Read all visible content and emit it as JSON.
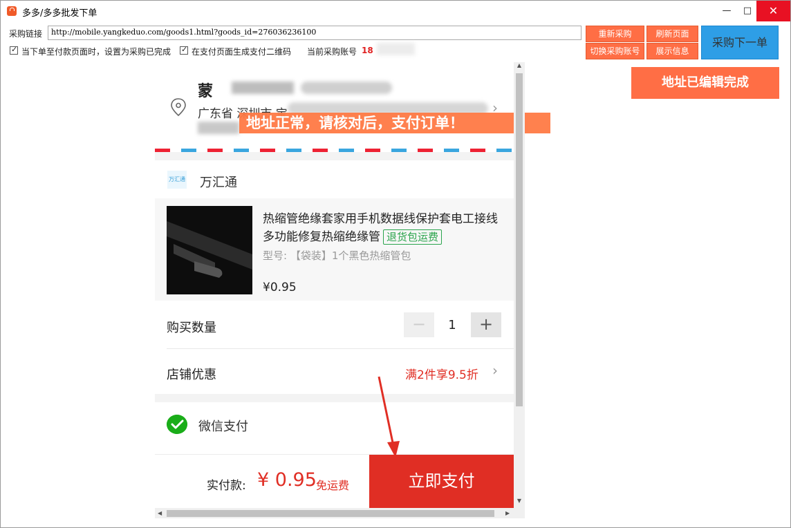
{
  "window": {
    "title": "多多/多多批发下单",
    "min_icon": "—",
    "max_icon": "□",
    "close_icon": "✕"
  },
  "toolbar": {
    "url_label": "采购链接",
    "url_value": "http://mobile.yangkeduo.com/goods1.html?goods_id=276036236100",
    "checkbox1_label": "当下单至付款页面时，设置为采购已完成",
    "checkbox2_label": "在支付页面生成支付二维码",
    "account_label": "当前采购账号",
    "account_value": "18",
    "redo_label": "重新采购",
    "refresh_label": "刷新页面",
    "switch_label": "切换采购账号",
    "info_label": "展示信息",
    "next_label": "采购下一单",
    "address_done_label": "地址已编辑完成"
  },
  "address": {
    "name": "蒙",
    "line": "广东省 深圳市 宝",
    "tip": "地址正常，请核对后，支付订单！"
  },
  "shop": {
    "logo_text": "万汇通",
    "name": "万汇通"
  },
  "product": {
    "title": "热缩管绝缘套家用手机数据线保护套电工接线多功能修复热缩绝缘管",
    "badge": "退货包运费",
    "spec": "型号: 【袋装】1个黑色热缩管包",
    "price": "¥0.95"
  },
  "quantity": {
    "label": "购买数量",
    "minus": "−",
    "value": "1",
    "plus": "+"
  },
  "coupon": {
    "label": "店铺优惠",
    "value": "满2件享9.5折"
  },
  "payment": {
    "method": "微信支付"
  },
  "footer": {
    "total_label": "实付款:",
    "total_amount": "¥ 0.95",
    "shipping": "免运费",
    "pay_button": "立即支付"
  },
  "colors": {
    "accent_orange": "#ff6e45",
    "blue_button": "#2e9ee6",
    "pdd_red": "#e02e24",
    "wechat_green": "#1aad19"
  }
}
